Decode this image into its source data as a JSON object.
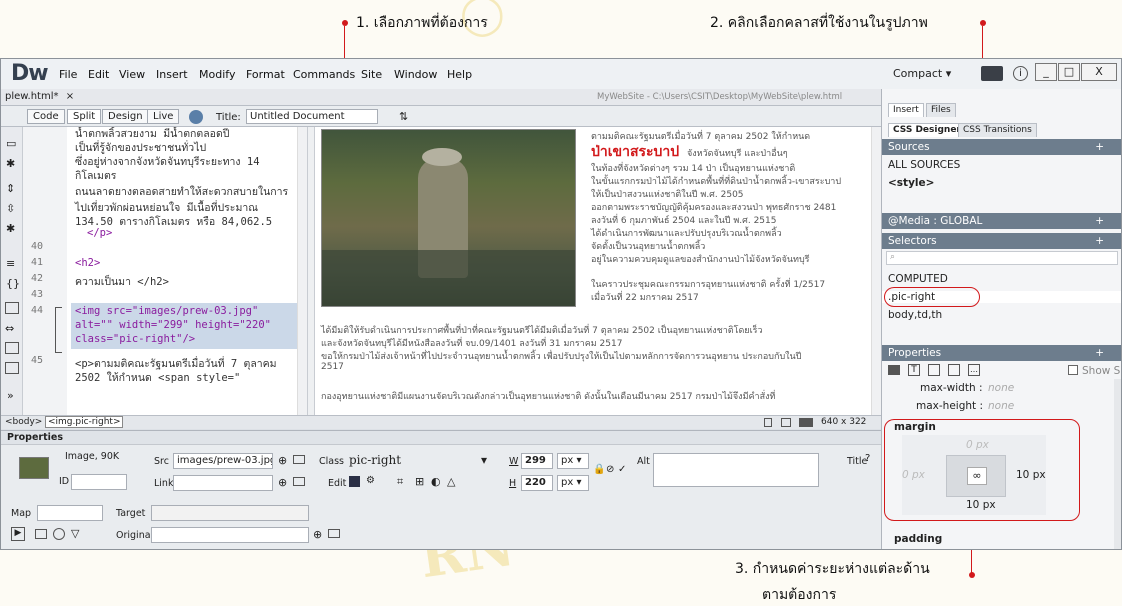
{
  "annotations": {
    "step1": "1. เลือกภาพที่ต้องการ",
    "step2": "2. คลิกเลือกคลาสที่ใช้งานในรูปภาพ",
    "step3_line1": "3. กำหนดค่าระยะห่างแต่ละด้าน",
    "step3_line2": "ตามต้องการ",
    "marker_color": "#d2191b"
  },
  "app": {
    "logo": "Dw",
    "menu": [
      "File",
      "Edit",
      "View",
      "Insert",
      "Modify",
      "Format",
      "Commands",
      "Site",
      "Window",
      "Help"
    ],
    "workspace": "Compact",
    "doc_tab": "plew.html*",
    "doc_tab_close": "×",
    "site_path": "MyWebSite - C:\\Users\\CSIT\\Desktop\\MyWebSite\\plew.html",
    "window_controls": [
      "_",
      "□",
      "X"
    ]
  },
  "toolbar": {
    "code": "Code",
    "split": "Split",
    "design": "Design",
    "live": "Live",
    "title_label": "Title:",
    "title_value": "Untitled Document"
  },
  "code": {
    "line_numbers": [
      "40",
      "41",
      "42",
      "43",
      "44",
      "",
      "",
      "45"
    ],
    "lines": [
      "น้ำตกพลิ้วสวยงาม มีน้ำตกตลอดปี",
      "เป็นที่รู้จักของประชาชนทั่วไป",
      "ซึ่งอยู่ห่างจากจังหวัดจันทบุรีระยะทาง 14",
      "กิโลเมตร",
      "ถนนลาดยางตลอดสายทำให้สะดวกสบายในการ",
      "ไปเที่ยวพักผ่อนหย่อนใจ มีเนื้อที่ประมาณ",
      "134.50 ตารางกิโลเมตร หรือ 84,062.5",
      "</p>",
      "",
      "<h2>",
      "ความเป็นมา </h2>",
      "",
      "<img src=\"images/prew-03.jpg\"",
      "alt=\"\" width=\"299\" height=\"220\"",
      " class=\"pic-right\"/>",
      "<p>ตามมติคณะรัฐมนตรีเมื่อวันที่ 7 ตุลาคม",
      "2502 ให้กำหนด <span style=\""
    ]
  },
  "design": {
    "heading_red": "ป่าเขาสระบาป",
    "lines": [
      "ตามมติคณะรัฐมนตรีเมื่อวันที่ 7 ตุลาคม 2502 ให้กำหนด",
      "จังหวัดจันทบุรี และป่าอื่นๆ",
      "ในท้องที่จังหวัดต่างๆ รวม 14 ป่า เป็นอุทยานแห่งชาติ",
      "ในขั้นแรกกรมป่าไม้ได้กำหนดพื้นที่ที่ดินป่าน้ำตกพลิ้ว-เขาสระบาป",
      "ให้เป็นป่าสงวนแห่งชาติในปี พ.ศ. 2505",
      "ออกตามพระราชบัญญัติคุ้มครองและสงวนป่า พุทธศักราช 2481",
      "ลงวันที่ 6 กุมภาพันธ์ 2504 และในปี พ.ศ. 2515",
      "ได้ดำเนินการพัฒนาและปรับปรุงบริเวณน้ำตกพลิ้ว",
      "จัดตั้งเป็นวนอุทยานน้ำตกพลิ้ว",
      "อยู่ในความควบคุมดูแลของสำนักงานป่าไม้จังหวัดจันทบุรี",
      "ในคราวประชุมคณะกรรมการอุทยานแห่งชาติ ครั้งที่ 1/2517",
      "เมื่อวันที่ 22 มกราคม 2517"
    ],
    "full_lines": [
      "ได้มีมติให้รับดำเนินการประกาศพื้นที่ป่าที่คณะรัฐมนตรีได้มีมติเมื่อวันที่ 7 ตุลาคม 2502 เป็นอุทยานแห่งชาติโดยเร็ว",
      "และจังหวัดจันทบุรีได้มีหนังสือลงวันที่ จบ.09/1401 ลงวันที่ 31 มกราคม 2517",
      "ขอให้กรมป่าไม้ส่งเจ้าหน้าที่ไปประจำวนอุทยานน้ำตกพลิ้ว เพื่อปรับปรุงให้เป็นไปตามหลักการจัดการวนอุทยาน ประกอบกับในปี",
      "2517",
      "กองอุทยานแห่งชาติมีแผนงานจัดบริเวณดังกล่าวเป็นอุทยานแห่งชาติ ดังนั้นในเดือนมีนาคม 2517 กรมป่าไม้จึงมีคำสั่งที่"
    ]
  },
  "status": {
    "tag_body": "<body>",
    "tag_img": "<img.pic-right>",
    "size": "640 x 322"
  },
  "properties": {
    "title": "Properties",
    "image_info": "Image, 90K",
    "src_label": "Src",
    "src_value": "images/prew-03.jpg",
    "class_label": "Class",
    "class_value": "pic-right",
    "w_label": "W",
    "w_value": "299",
    "h_label": "H",
    "h_value": "220",
    "unit": "px",
    "id_label": "ID",
    "link_label": "Link",
    "edit_label": "Edit",
    "alt_label": "Alt",
    "title_label": "Title",
    "map_label": "Map",
    "target_label": "Target",
    "original_label": "Original"
  },
  "right_panel": {
    "tabs_top": [
      "Insert",
      "Files"
    ],
    "tabs_css": [
      "CSS Designer",
      "CSS Transitions"
    ],
    "sources_header": "Sources",
    "sources": [
      "ALL SOURCES",
      "<style>"
    ],
    "media_header": "@Media : GLOBAL",
    "selectors_header": "Selectors",
    "selectors": [
      "COMPUTED",
      ".pic-right",
      "body,td,th"
    ],
    "properties_header": "Properties",
    "show_set": "Show Set",
    "max_width_label": "max-width :",
    "max_width_value": "none",
    "max_height_label": "max-height :",
    "max_height_value": "none",
    "margin_label": "margin",
    "margin_top": "0 px",
    "margin_left": "0 px",
    "margin_right": "10 px",
    "margin_bottom": "10 px",
    "padding_label": "padding"
  }
}
